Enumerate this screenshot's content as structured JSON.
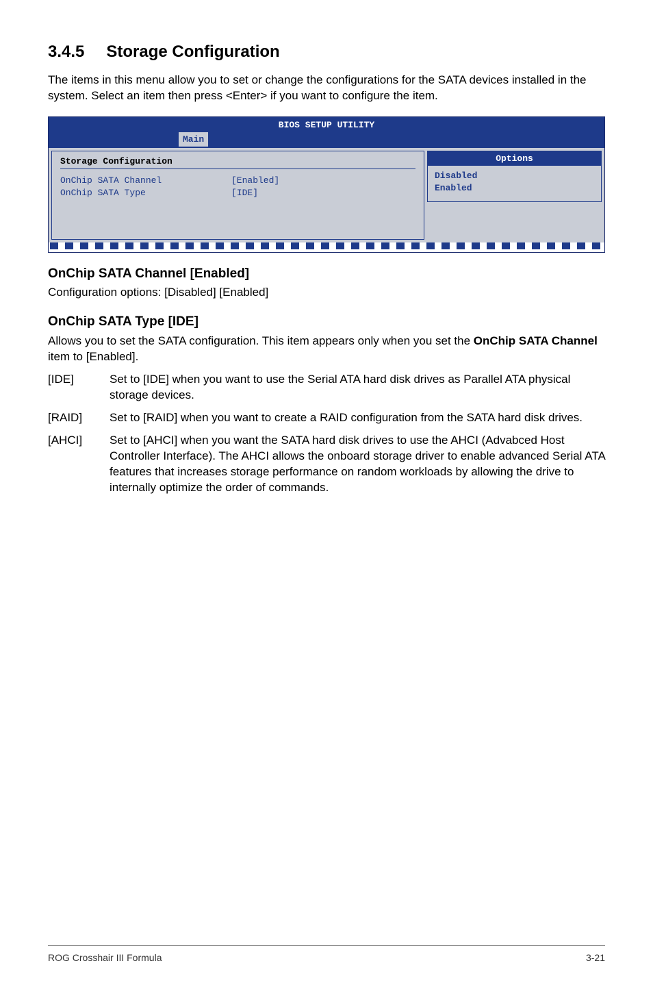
{
  "section": {
    "number": "3.4.5",
    "title": "Storage Configuration"
  },
  "intro": "The items in this menu allow you to set or change the configurations for the SATA devices installed in the system. Select an item then press <Enter> if you want to configure the item.",
  "bios": {
    "title": "BIOS SETUP UTILITY",
    "active_tab": "Main",
    "panel_heading": "Storage Configuration",
    "rows": [
      {
        "label": "OnChip SATA Channel",
        "value": "[Enabled]"
      },
      {
        "label": "OnChip SATA Type",
        "value": "[IDE]"
      }
    ],
    "options_title": "Options",
    "options": [
      "Disabled",
      "Enabled"
    ]
  },
  "sub1": {
    "heading": "OnChip SATA Channel [Enabled]",
    "body": "Configuration options: [Disabled] [Enabled]"
  },
  "sub2": {
    "heading": "OnChip SATA Type [IDE]",
    "body_pre": "Allows you to set the SATA configuration. This item appears only when you set the ",
    "body_bold": "OnChip SATA Channel",
    "body_post": " item to [Enabled]."
  },
  "options": [
    {
      "key": "[IDE]",
      "desc": "Set to [IDE] when you want to use the Serial ATA hard disk drives as Parallel ATA physical storage devices."
    },
    {
      "key": "[RAID]",
      "desc": "Set to [RAID] when you want to create a RAID configuration from the SATA hard disk drives."
    },
    {
      "key": "[AHCI]",
      "desc": "Set to [AHCI] when you want the SATA hard disk drives to use the AHCI (Advabced Host Controller Interface). The AHCI allows the onboard storage driver to enable advanced Serial ATA features that increases storage performance on random workloads by allowing the drive to internally optimize the order of commands."
    }
  ],
  "footer": {
    "left": "ROG Crosshair III Formula",
    "right": "3-21"
  }
}
